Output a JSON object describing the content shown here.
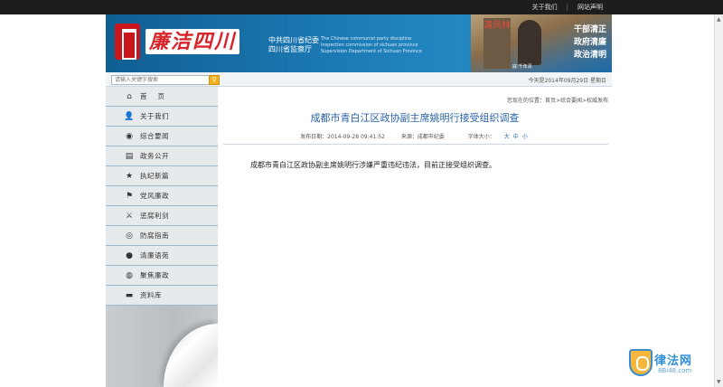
{
  "topbar": {
    "links": [
      "关于我们",
      "网站声明"
    ],
    "separator": "|"
  },
  "banner": {
    "logo_text": "廉洁四川",
    "org_cn": [
      "中共四川省纪委",
      "四川省监察厅"
    ],
    "org_en": [
      "The Chinese communist party discipline",
      "inspection commission of sichuan province",
      "Supervision Department of Sichuan Province"
    ],
    "stele_text": "清风林",
    "statue_caption": "寇·千年清",
    "slogan": [
      "干部清正",
      "政府清廉",
      "政治清明"
    ]
  },
  "search": {
    "placeholder": "请输入关键字搜索",
    "button_icon": "search-icon",
    "date_text": "今天是2014年09月29日 星期日"
  },
  "nav": [
    {
      "label": "首页",
      "icon": "home-icon",
      "glyph": "⌂"
    },
    {
      "label": "关于我们",
      "icon": "user-icon",
      "glyph": "👤"
    },
    {
      "label": "综合要闻",
      "icon": "eye-icon",
      "glyph": "◉"
    },
    {
      "label": "政务公开",
      "icon": "document-icon",
      "glyph": "▤"
    },
    {
      "label": "执纪新篇",
      "icon": "star-icon",
      "glyph": "★"
    },
    {
      "label": "党风廉政",
      "icon": "flag-icon",
      "glyph": "⚑"
    },
    {
      "label": "惩腐利剑",
      "icon": "sword-icon",
      "glyph": "⚔"
    },
    {
      "label": "防腐指南",
      "icon": "compass-icon",
      "glyph": "◎"
    },
    {
      "label": "清廉语苑",
      "icon": "chat-icon",
      "glyph": "●"
    },
    {
      "label": "聚焦廉政",
      "icon": "globe-icon",
      "glyph": "◍"
    },
    {
      "label": "资料库",
      "icon": "folder-icon",
      "glyph": "▬"
    }
  ],
  "article": {
    "breadcrumb": "您现在的位置：首页>综合要闻>权威发布",
    "title": "成都市青白江区政协副主席姚明行接受组织调查",
    "publish_date": "发布日期：2014-09-28 09:41:52",
    "source": "来源：成都市纪委",
    "font_size_label": "字体大小：",
    "font_sizes": [
      "大",
      "中",
      "小"
    ],
    "body": "成都市青白江区政协副主席姚明行涉嫌严重违纪违法，目前正接受组织调查。"
  },
  "watermark": {
    "name": "律法网",
    "url": "8Bi48.com"
  }
}
